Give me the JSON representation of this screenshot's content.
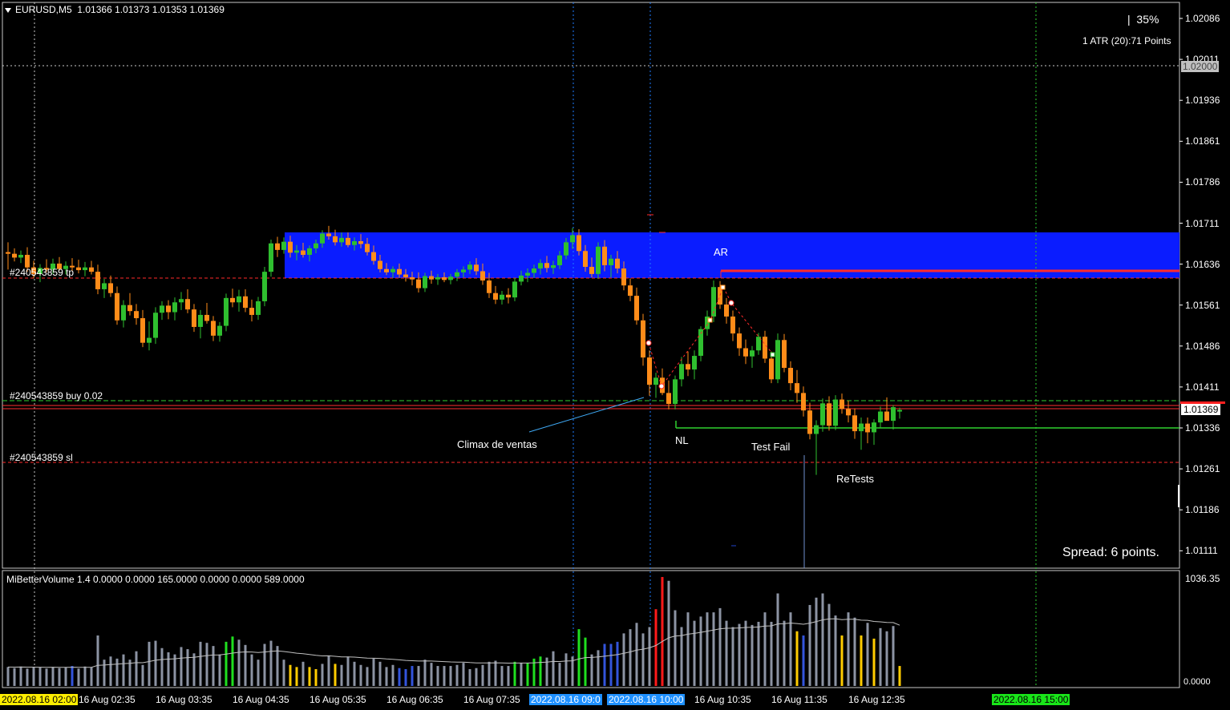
{
  "symbol_header": {
    "arrow_icon": "triangle-down-icon",
    "symbol": "EURUSD,M5",
    "ohlc": "1.01366 1.01373 1.01353 1.01369"
  },
  "top_right": {
    "zoom": "35%",
    "atr": "1 ATR (20):71 Points"
  },
  "price_axis": [
    "1.02086",
    "1.02011",
    "1.01936",
    "1.01861",
    "1.01786",
    "1.01711",
    "1.01636",
    "1.01561",
    "1.01486",
    "1.01411",
    "1.01336",
    "1.01261",
    "1.01186",
    "1.01111"
  ],
  "price_tags": {
    "level_line": "1.02000",
    "current": "1.01369"
  },
  "trade_labels": {
    "tp": "#240543859 tp",
    "buy": "#240543859 buy 0.02",
    "sl": "#240543859 sl"
  },
  "annotations": {
    "ar": "AR",
    "climax": "Climax de ventas",
    "nl": "NL",
    "test_fail": "Test Fail",
    "retests": "ReTests"
  },
  "spread": "Spread: 6 points.",
  "indicator": {
    "title": "MiBetterVolume 1.4 0.0000 0.0000 165.0000 0.0000 0.0000 589.0000",
    "max": "1036.35",
    "min": "0.0000"
  },
  "time_axis": {
    "start_tag": "2022.08.16 02:00",
    "labels": [
      "16 Aug 02:35",
      "16 Aug 03:35",
      "16 Aug 04:35",
      "16 Aug 05:35",
      "16 Aug 06:35",
      "16 Aug 07:35",
      "16 Aug 10:35",
      "16 Aug 11:35",
      "16 Aug 12:35"
    ],
    "tag_blue1": "2022.08.16 09:0",
    "tag_blue2": "2022.08.16 10:00",
    "tag_green": "2022.08.16 15:00"
  },
  "colors": {
    "bull": "#2fbf2f",
    "bear": "#ff8c19",
    "zone": "#0a1cff",
    "vol_gray": "#8c93a3",
    "vol_red": "#ff1a1a",
    "vol_green": "#1fe01f",
    "vol_blue": "#3355dd",
    "vol_yellow": "#ffcc00"
  },
  "candles": [
    [
      1.01658,
      1.01676,
      1.01626,
      1.01655
    ],
    [
      1.01655,
      1.01665,
      1.01641,
      1.01648
    ],
    [
      1.01648,
      1.01661,
      1.01638,
      1.01653
    ],
    [
      1.01653,
      1.01667,
      1.01622,
      1.0163
    ],
    [
      1.0163,
      1.01642,
      1.0161,
      1.01618
    ],
    [
      1.01618,
      1.01636,
      1.01603,
      1.01629
    ],
    [
      1.01629,
      1.01645,
      1.01621,
      1.01626
    ],
    [
      1.01626,
      1.01646,
      1.01618,
      1.01637
    ],
    [
      1.01637,
      1.01649,
      1.01624,
      1.01627
    ],
    [
      1.01627,
      1.01641,
      1.01617,
      1.01633
    ],
    [
      1.01633,
      1.01647,
      1.01623,
      1.0163
    ],
    [
      1.0163,
      1.01644,
      1.01619,
      1.01625
    ],
    [
      1.01625,
      1.0164,
      1.01614,
      1.0163
    ],
    [
      1.0163,
      1.01642,
      1.01617,
      1.01622
    ],
    [
      1.01622,
      1.01635,
      1.01581,
      1.0159
    ],
    [
      1.0159,
      1.01609,
      1.01574,
      1.01601
    ],
    [
      1.01601,
      1.01615,
      1.01576,
      1.01583
    ],
    [
      1.01583,
      1.01595,
      1.01525,
      1.01533
    ],
    [
      1.01533,
      1.0157,
      1.0152,
      1.01561
    ],
    [
      1.01561,
      1.01583,
      1.01542,
      1.0155
    ],
    [
      1.0155,
      1.01563,
      1.01525,
      1.01537
    ],
    [
      1.01537,
      1.01552,
      1.01484,
      1.01492
    ],
    [
      1.01492,
      1.01531,
      1.01478,
      1.01501
    ],
    [
      1.01501,
      1.01557,
      1.0149,
      1.01547
    ],
    [
      1.01547,
      1.01568,
      1.01534,
      1.0156
    ],
    [
      1.0156,
      1.0157,
      1.01535,
      1.01548
    ],
    [
      1.01548,
      1.01575,
      1.01533,
      1.01566
    ],
    [
      1.01566,
      1.01585,
      1.01552,
      1.01572
    ],
    [
      1.01572,
      1.0159,
      1.01546,
      1.01553
    ],
    [
      1.01553,
      1.01563,
      1.01512,
      1.01521
    ],
    [
      1.01521,
      1.01552,
      1.015,
      1.01543
    ],
    [
      1.01543,
      1.01565,
      1.01527,
      1.01532
    ],
    [
      1.01532,
      1.01541,
      1.01495,
      1.01505
    ],
    [
      1.01505,
      1.0153,
      1.01494,
      1.01523
    ],
    [
      1.01523,
      1.01582,
      1.01513,
      1.01574
    ],
    [
      1.01574,
      1.01591,
      1.01557,
      1.01566
    ],
    [
      1.01566,
      1.01589,
      1.01549,
      1.01577
    ],
    [
      1.01577,
      1.0159,
      1.01548,
      1.01556
    ],
    [
      1.01556,
      1.01571,
      1.01531,
      1.01543
    ],
    [
      1.01543,
      1.01576,
      1.01534,
      1.01568
    ],
    [
      1.01568,
      1.01631,
      1.01559,
      1.01622
    ],
    [
      1.01622,
      1.01681,
      1.01613,
      1.01674
    ],
    [
      1.01674,
      1.01686,
      1.01649,
      1.01662
    ],
    [
      1.01662,
      1.01685,
      1.01655,
      1.01677
    ],
    [
      1.01677,
      1.01688,
      1.01648,
      1.01657
    ],
    [
      1.01657,
      1.01671,
      1.01643,
      1.01661
    ],
    [
      1.01661,
      1.01675,
      1.01648,
      1.01653
    ],
    [
      1.01653,
      1.0167,
      1.01641,
      1.01665
    ],
    [
      1.01665,
      1.01681,
      1.01656,
      1.01674
    ],
    [
      1.01674,
      1.01698,
      1.01666,
      1.01692
    ],
    [
      1.01692,
      1.01706,
      1.01681,
      1.01687
    ],
    [
      1.01687,
      1.01699,
      1.0167,
      1.01676
    ],
    [
      1.01676,
      1.01694,
      1.01668,
      1.01684
    ],
    [
      1.01684,
      1.01694,
      1.01667,
      1.01671
    ],
    [
      1.01671,
      1.01685,
      1.01661,
      1.01678
    ],
    [
      1.01678,
      1.01691,
      1.01665,
      1.01673
    ],
    [
      1.01673,
      1.01684,
      1.01652,
      1.01658
    ],
    [
      1.01658,
      1.0167,
      1.01635,
      1.01642
    ],
    [
      1.01642,
      1.01653,
      1.01621,
      1.01627
    ],
    [
      1.01627,
      1.01638,
      1.01616,
      1.01621
    ],
    [
      1.01621,
      1.01632,
      1.01611,
      1.01627
    ],
    [
      1.01627,
      1.01637,
      1.01611,
      1.01617
    ],
    [
      1.01617,
      1.01627,
      1.01604,
      1.01612
    ],
    [
      1.01612,
      1.01622,
      1.01597,
      1.01608
    ],
    [
      1.01608,
      1.01621,
      1.01584,
      1.01592
    ],
    [
      1.01592,
      1.0162,
      1.01585,
      1.01614
    ],
    [
      1.01614,
      1.01624,
      1.016,
      1.01608
    ],
    [
      1.01608,
      1.01618,
      1.01598,
      1.01612
    ],
    [
      1.01612,
      1.01621,
      1.01603,
      1.01607
    ],
    [
      1.01607,
      1.01618,
      1.01599,
      1.01613
    ],
    [
      1.01613,
      1.01627,
      1.01605,
      1.01621
    ],
    [
      1.01621,
      1.01632,
      1.01612,
      1.01626
    ],
    [
      1.01626,
      1.01641,
      1.01618,
      1.01635
    ],
    [
      1.01635,
      1.01647,
      1.01616,
      1.01623
    ],
    [
      1.01623,
      1.01637,
      1.01598,
      1.01606
    ],
    [
      1.01606,
      1.0162,
      1.01574,
      1.01583
    ],
    [
      1.01583,
      1.01596,
      1.01563,
      1.01571
    ],
    [
      1.01571,
      1.01587,
      1.01562,
      1.0158
    ],
    [
      1.0158,
      1.01592,
      1.01564,
      1.01575
    ],
    [
      1.01575,
      1.01611,
      1.01568,
      1.01604
    ],
    [
      1.01604,
      1.01624,
      1.01597,
      1.01615
    ],
    [
      1.01615,
      1.01628,
      1.01603,
      1.0162
    ],
    [
      1.0162,
      1.01635,
      1.01611,
      1.01628
    ],
    [
      1.01628,
      1.01645,
      1.01617,
      1.01638
    ],
    [
      1.01638,
      1.01651,
      1.01621,
      1.01629
    ],
    [
      1.01629,
      1.01642,
      1.01618,
      1.01634
    ],
    [
      1.01634,
      1.0166,
      1.01627,
      1.01652
    ],
    [
      1.01652,
      1.01684,
      1.01645,
      1.01676
    ],
    [
      1.01676,
      1.01702,
      1.01664,
      1.01689
    ],
    [
      1.01689,
      1.017,
      1.01652,
      1.0166
    ],
    [
      1.0166,
      1.01671,
      1.01622,
      1.01631
    ],
    [
      1.01631,
      1.01648,
      1.01612,
      1.01618
    ],
    [
      1.01618,
      1.01676,
      1.01609,
      1.01668
    ],
    [
      1.01668,
      1.0168,
      1.01623,
      1.01634
    ],
    [
      1.01634,
      1.01653,
      1.01612,
      1.01646
    ],
    [
      1.01646,
      1.0166,
      1.01619,
      1.01628
    ],
    [
      1.01628,
      1.01641,
      1.01588,
      1.01597
    ],
    [
      1.01597,
      1.0161,
      1.01568,
      1.01578
    ],
    [
      1.01578,
      1.01593,
      1.01525,
      1.01533
    ],
    [
      1.01533,
      1.01545,
      1.0145,
      1.01465
    ],
    [
      1.01465,
      1.01478,
      1.01395,
      1.01415
    ],
    [
      1.01415,
      1.01437,
      1.01391,
      1.01428
    ],
    [
      1.01428,
      1.01445,
      1.01396,
      1.014
    ],
    [
      1.014,
      1.01423,
      1.0137,
      1.0138
    ],
    [
      1.0138,
      1.01432,
      1.0137,
      1.01425
    ],
    [
      1.01425,
      1.01466,
      1.01412,
      1.01453
    ],
    [
      1.01453,
      1.01476,
      1.01431,
      1.01443
    ],
    [
      1.01443,
      1.01478,
      1.01425,
      1.01468
    ],
    [
      1.01468,
      1.01522,
      1.01458,
      1.01517
    ],
    [
      1.01517,
      1.01551,
      1.01505,
      1.0154
    ],
    [
      1.0154,
      1.01606,
      1.0153,
      1.01594
    ],
    [
      1.01594,
      1.01605,
      1.01554,
      1.01562
    ],
    [
      1.01562,
      1.01574,
      1.01527,
      1.0154
    ],
    [
      1.0154,
      1.01551,
      1.01495,
      1.01509
    ],
    [
      1.01509,
      1.0152,
      1.01468,
      1.01482
    ],
    [
      1.01482,
      1.01498,
      1.01453,
      1.01467
    ],
    [
      1.01467,
      1.01486,
      1.01446,
      1.01478
    ],
    [
      1.01478,
      1.0151,
      1.0147,
      1.01503
    ],
    [
      1.01503,
      1.01514,
      1.01455,
      1.01463
    ],
    [
      1.01463,
      1.01476,
      1.01418,
      1.01425
    ],
    [
      1.01425,
      1.01509,
      1.01418,
      1.01497
    ],
    [
      1.01497,
      1.01508,
      1.01438,
      1.01446
    ],
    [
      1.01446,
      1.01458,
      1.01405,
      1.01418
    ],
    [
      1.01418,
      1.01442,
      1.01382,
      1.014
    ],
    [
      1.014,
      1.01412,
      1.01357,
      1.01368
    ],
    [
      1.01368,
      1.01382,
      1.01315,
      1.01325
    ],
    [
      1.01325,
      1.0135,
      1.0125,
      1.01341
    ],
    [
      1.01341,
      1.0139,
      1.01329,
      1.01381
    ],
    [
      1.01381,
      1.01394,
      1.01331,
      1.0134
    ],
    [
      1.0134,
      1.01396,
      1.01332,
      1.01388
    ],
    [
      1.01388,
      1.01399,
      1.01362,
      1.01371
    ],
    [
      1.01371,
      1.01386,
      1.01346,
      1.01359
    ],
    [
      1.01359,
      1.01372,
      1.01316,
      1.0133
    ],
    [
      1.0133,
      1.01355,
      1.01296,
      1.01344
    ],
    [
      1.01344,
      1.01355,
      1.01308,
      1.01328
    ],
    [
      1.01328,
      1.01352,
      1.01305,
      1.01346
    ],
    [
      1.01346,
      1.01375,
      1.01336,
      1.01366
    ],
    [
      1.01366,
      1.01392,
      1.01355,
      1.01349
    ],
    [
      1.01349,
      1.01378,
      1.01333,
      1.01374
    ],
    [
      1.01366,
      1.01373,
      1.01353,
      1.01369
    ]
  ],
  "volumes": [
    [
      180,
      "g"
    ],
    [
      170,
      "g"
    ],
    [
      185,
      "g"
    ],
    [
      165,
      "g"
    ],
    [
      180,
      "g"
    ],
    [
      175,
      "g"
    ],
    [
      165,
      "g"
    ],
    [
      180,
      "g"
    ],
    [
      170,
      "g"
    ],
    [
      175,
      "g"
    ],
    [
      190,
      "b"
    ],
    [
      165,
      "g"
    ],
    [
      185,
      "g"
    ],
    [
      175,
      "g"
    ],
    [
      480,
      "g"
    ],
    [
      250,
      "g"
    ],
    [
      280,
      "g"
    ],
    [
      260,
      "g"
    ],
    [
      300,
      "g"
    ],
    [
      250,
      "g"
    ],
    [
      330,
      "g"
    ],
    [
      200,
      "g"
    ],
    [
      420,
      "g"
    ],
    [
      430,
      "g"
    ],
    [
      360,
      "g"
    ],
    [
      320,
      "g"
    ],
    [
      300,
      "g"
    ],
    [
      370,
      "g"
    ],
    [
      350,
      "g"
    ],
    [
      310,
      "g"
    ],
    [
      420,
      "g"
    ],
    [
      410,
      "g"
    ],
    [
      380,
      "g"
    ],
    [
      300,
      "g"
    ],
    [
      420,
      "gr"
    ],
    [
      470,
      "gr"
    ],
    [
      440,
      "g"
    ],
    [
      390,
      "g"
    ],
    [
      300,
      "g"
    ],
    [
      250,
      "g"
    ],
    [
      400,
      "g"
    ],
    [
      430,
      "g"
    ],
    [
      380,
      "g"
    ],
    [
      250,
      "g"
    ],
    [
      200,
      "y"
    ],
    [
      180,
      "y"
    ],
    [
      230,
      "g"
    ],
    [
      180,
      "y"
    ],
    [
      160,
      "y"
    ],
    [
      210,
      "g"
    ],
    [
      290,
      "g"
    ],
    [
      210,
      "y"
    ],
    [
      200,
      "g"
    ],
    [
      280,
      "g"
    ],
    [
      230,
      "g"
    ],
    [
      200,
      "g"
    ],
    [
      180,
      "g"
    ],
    [
      260,
      "g"
    ],
    [
      230,
      "g"
    ],
    [
      180,
      "g"
    ],
    [
      200,
      "g"
    ],
    [
      170,
      "b"
    ],
    [
      160,
      "b"
    ],
    [
      190,
      "b"
    ],
    [
      190,
      "g"
    ],
    [
      250,
      "g"
    ],
    [
      220,
      "g"
    ],
    [
      190,
      "g"
    ],
    [
      190,
      "g"
    ],
    [
      190,
      "g"
    ],
    [
      200,
      "g"
    ],
    [
      220,
      "g"
    ],
    [
      160,
      "g"
    ],
    [
      170,
      "g"
    ],
    [
      200,
      "g"
    ],
    [
      230,
      "g"
    ],
    [
      240,
      "g"
    ],
    [
      190,
      "g"
    ],
    [
      190,
      "g"
    ],
    [
      230,
      "gr"
    ],
    [
      220,
      "g"
    ],
    [
      220,
      "gr"
    ],
    [
      260,
      "gr"
    ],
    [
      280,
      "gr"
    ],
    [
      270,
      "g"
    ],
    [
      330,
      "g"
    ],
    [
      220,
      "g"
    ],
    [
      310,
      "g"
    ],
    [
      280,
      "g"
    ],
    [
      540,
      "gr"
    ],
    [
      460,
      "gr"
    ],
    [
      300,
      "g"
    ],
    [
      340,
      "g"
    ],
    [
      400,
      "b"
    ],
    [
      400,
      "b"
    ],
    [
      420,
      "b"
    ],
    [
      500,
      "g"
    ],
    [
      540,
      "g"
    ],
    [
      600,
      "g"
    ],
    [
      500,
      "g"
    ],
    [
      560,
      "g"
    ],
    [
      730,
      "r"
    ],
    [
      1036,
      "r"
    ],
    [
      1000,
      "g"
    ],
    [
      720,
      "g"
    ],
    [
      560,
      "g"
    ],
    [
      700,
      "g"
    ],
    [
      620,
      "g"
    ],
    [
      660,
      "g"
    ],
    [
      700,
      "g"
    ],
    [
      700,
      "g"
    ],
    [
      740,
      "g"
    ],
    [
      620,
      "g"
    ],
    [
      560,
      "g"
    ],
    [
      590,
      "g"
    ],
    [
      620,
      "g"
    ],
    [
      580,
      "g"
    ],
    [
      610,
      "g"
    ],
    [
      700,
      "g"
    ],
    [
      610,
      "g"
    ],
    [
      880,
      "g"
    ],
    [
      620,
      "g"
    ],
    [
      700,
      "g"
    ],
    [
      520,
      "y"
    ],
    [
      480,
      "b"
    ],
    [
      770,
      "g"
    ],
    [
      840,
      "g"
    ],
    [
      880,
      "g"
    ],
    [
      780,
      "g"
    ],
    [
      670,
      "g"
    ],
    [
      480,
      "y"
    ],
    [
      700,
      "g"
    ],
    [
      650,
      "g"
    ],
    [
      480,
      "y"
    ],
    [
      600,
      "g"
    ],
    [
      450,
      "y"
    ],
    [
      550,
      "g"
    ],
    [
      520,
      "g"
    ],
    [
      570,
      "g"
    ],
    [
      190,
      "y"
    ]
  ]
}
